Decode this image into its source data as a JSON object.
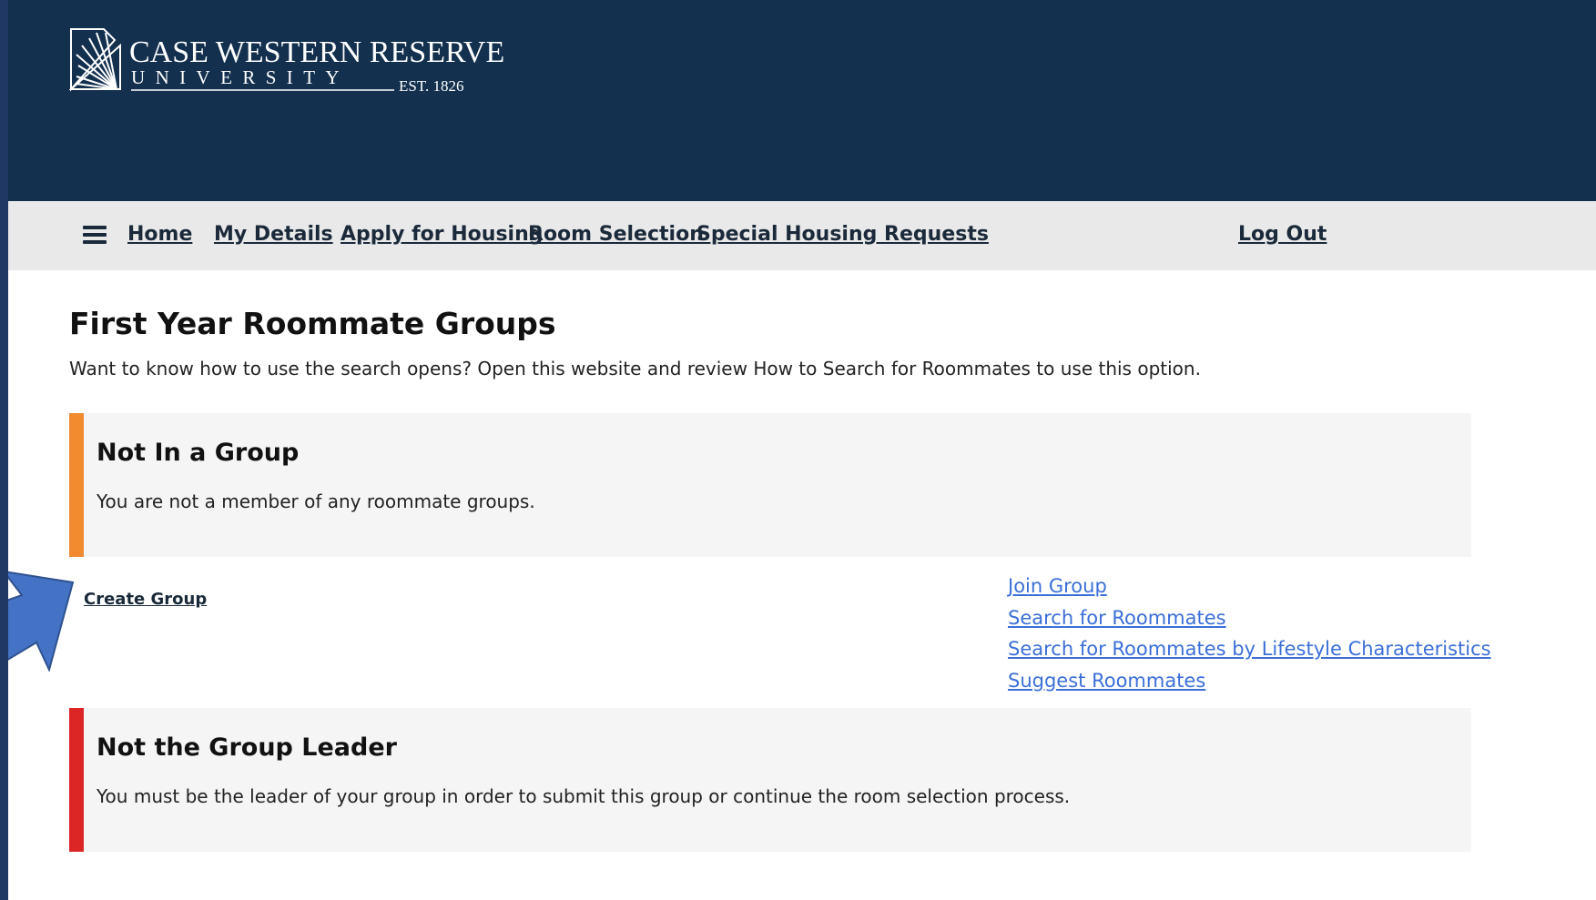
{
  "brand": {
    "name_line1": "CASE WESTERN RESERVE",
    "name_line2": "UNIVERSITY",
    "established": "EST. 1826",
    "header_color": "#13304f"
  },
  "nav": {
    "menu_icon": "hamburger-menu-icon",
    "items": [
      {
        "label": "Home"
      },
      {
        "label": "My Details"
      },
      {
        "label": "Apply for Housing"
      },
      {
        "label": "Room Selection"
      },
      {
        "label": "Special Housing Requests"
      }
    ],
    "logout_label": "Log Out"
  },
  "page": {
    "title": "First Year Roommate Groups",
    "intro": "Want to know how to use the search opens? Open this website and review How to Search for Roommates to use this option."
  },
  "not_in_group": {
    "title": "Not In a Group",
    "message": "You are not a member of any roommate groups.",
    "accent_color": "#f28a30"
  },
  "actions": {
    "create_group": "Create Group",
    "links": [
      {
        "label": "Join Group"
      },
      {
        "label": "Search for Roommates"
      },
      {
        "label": "Search for Roommates by Lifestyle Characteristics"
      },
      {
        "label": "Suggest Roommates"
      }
    ],
    "link_color": "#3b6fd8"
  },
  "not_leader": {
    "title": "Not the Group Leader",
    "message": "You must be the leader of your group in order to submit this group or continue the room selection process.",
    "accent_color": "#dc2626"
  },
  "annotation": {
    "icon": "callout-arrow-icon",
    "color": "#4472c4"
  }
}
